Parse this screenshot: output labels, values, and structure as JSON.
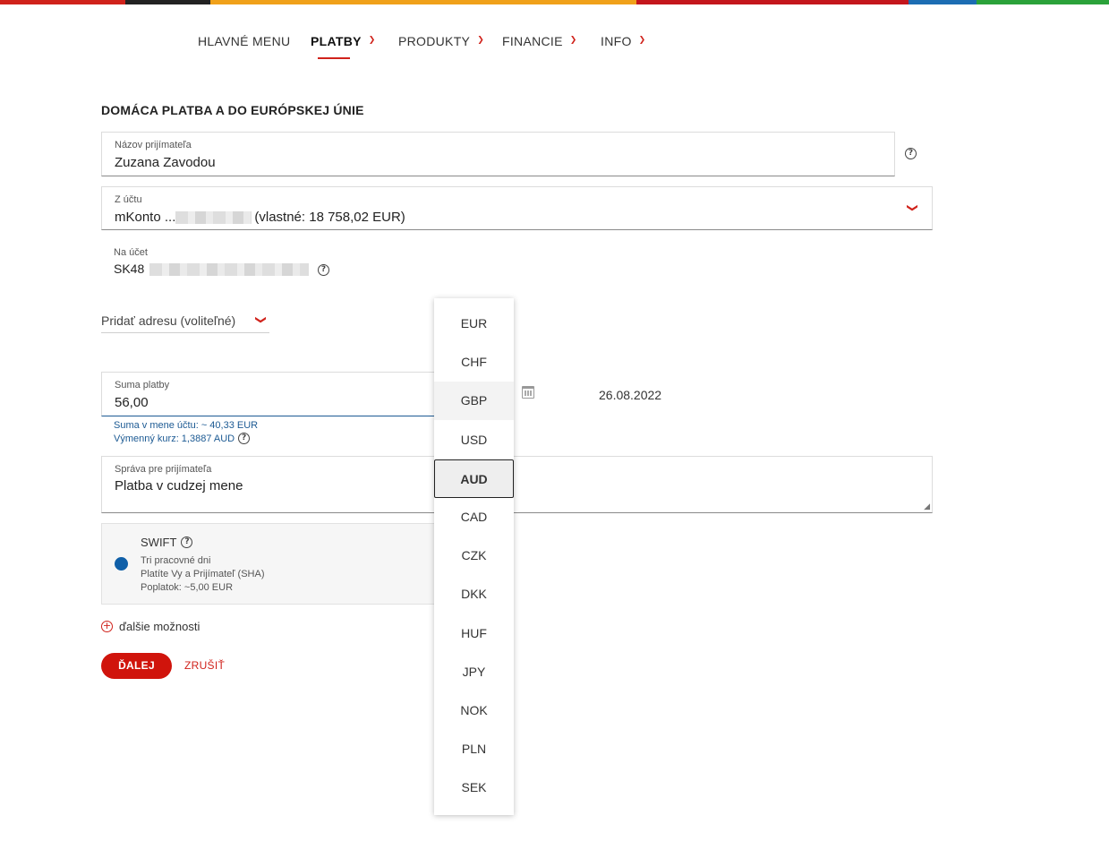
{
  "topbar_colors": [
    "#d0221b",
    "#222222",
    "#f0a11a",
    "#c4161c",
    "#1c6db3",
    "#2ba23a"
  ],
  "nav": {
    "items": [
      {
        "label": "HLAVNÉ MENU",
        "has_dropdown": false
      },
      {
        "label": "PLATBY",
        "has_dropdown": true,
        "active": true
      },
      {
        "label": "PRODUKTY",
        "has_dropdown": true
      },
      {
        "label": "FINANCIE",
        "has_dropdown": true
      },
      {
        "label": "INFO",
        "has_dropdown": true
      }
    ]
  },
  "form": {
    "title": "DOMÁCA PLATBA A DO EURÓPSKEJ ÚNIE",
    "recipient": {
      "label": "Názov prijímateľa",
      "value": "Zuzana Zavodou"
    },
    "from_account": {
      "label": "Z účtu",
      "value_prefix": "mKonto ...",
      "value_suffix": "(vlastné: 18 758,02 EUR)"
    },
    "to_account": {
      "label": "Na účet",
      "value_prefix": "SK48"
    },
    "address": {
      "label": "Pridať adresu (voliteľné)"
    },
    "amount": {
      "label": "Suma platby",
      "value": "56,00",
      "account_currency_amount": "Suma v mene účtu: ~ 40,33 EUR",
      "exchange_rate": "Výmenný kurz: 1,3887 AUD"
    },
    "date": "26.08.2022",
    "message": {
      "label": "Správa pre prijímateľa",
      "value": "Platba v cudzej mene"
    },
    "swift": {
      "title": "SWIFT",
      "line1": "Tri pracovné dni",
      "line2": "Platíte Vy a Prijímateľ (SHA)",
      "line3": "Poplatok: ~5,00 EUR"
    },
    "more_options": "ďalšie možnosti",
    "next_button": "ĎALEJ",
    "cancel_button": "ZRUŠIŤ"
  },
  "currency_dropdown": {
    "options": [
      "EUR",
      "CHF",
      "GBP",
      "USD",
      "AUD",
      "CAD",
      "CZK",
      "DKK",
      "HUF",
      "JPY",
      "NOK",
      "PLN",
      "SEK"
    ],
    "selected": "AUD",
    "hovered": "GBP"
  },
  "icons": {
    "help": "help-icon",
    "chevron": "chevron-down-icon",
    "calendar": "calendar-icon",
    "plus": "plus-circle-icon"
  }
}
